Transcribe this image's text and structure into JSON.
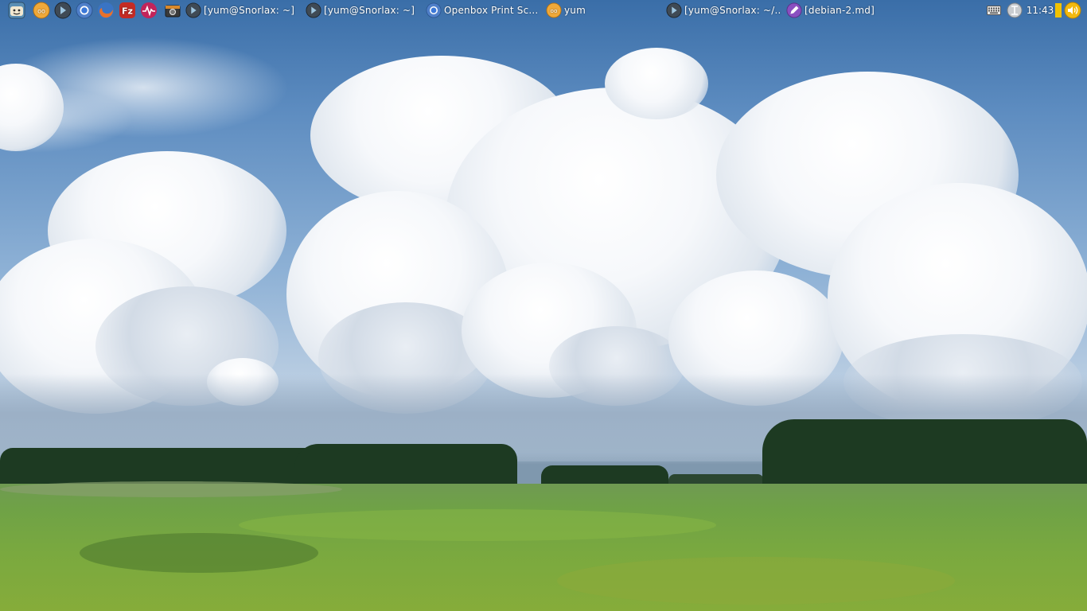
{
  "launchers": [
    {
      "name": "file-manager-launcher",
      "icon": "smiling-face-icon"
    },
    {
      "name": "pidgin-launcher",
      "icon": "chat-bubbles-icon"
    },
    {
      "name": "terminal-launcher",
      "icon": "terminal-icon"
    },
    {
      "name": "chromium-launcher",
      "icon": "chromium-icon"
    },
    {
      "name": "firefox-launcher",
      "icon": "firefox-icon"
    },
    {
      "name": "filezilla-launcher",
      "icon": "filezilla-icon"
    },
    {
      "name": "system-monitor-launcher",
      "icon": "pulse-icon"
    },
    {
      "name": "camera-launcher",
      "icon": "camera-icon"
    }
  ],
  "tasks": [
    {
      "label": "[yum@Snorlax: ~]",
      "icon": "terminal-icon"
    },
    {
      "label": "[yum@Snorlax: ~]",
      "icon": "terminal-icon"
    },
    {
      "label": "Openbox Print Sc...",
      "icon": "chromium-icon"
    },
    {
      "label": "yum",
      "icon": "chat-bubbles-icon"
    },
    {
      "label": "[yum@Snorlax: ~/...",
      "icon": "terminal-icon"
    },
    {
      "label": "[debian-2.md]",
      "icon": "text-editor-icon"
    }
  ],
  "tray": {
    "keyboard_icon": "keyboard-icon",
    "network_icon": "network-icon",
    "clock": "11:43",
    "volume_icon": "volume-icon",
    "volume_level": 1.0
  },
  "colors": {
    "panel_text": "#ffffff",
    "volume_bar": "#f2c200"
  }
}
